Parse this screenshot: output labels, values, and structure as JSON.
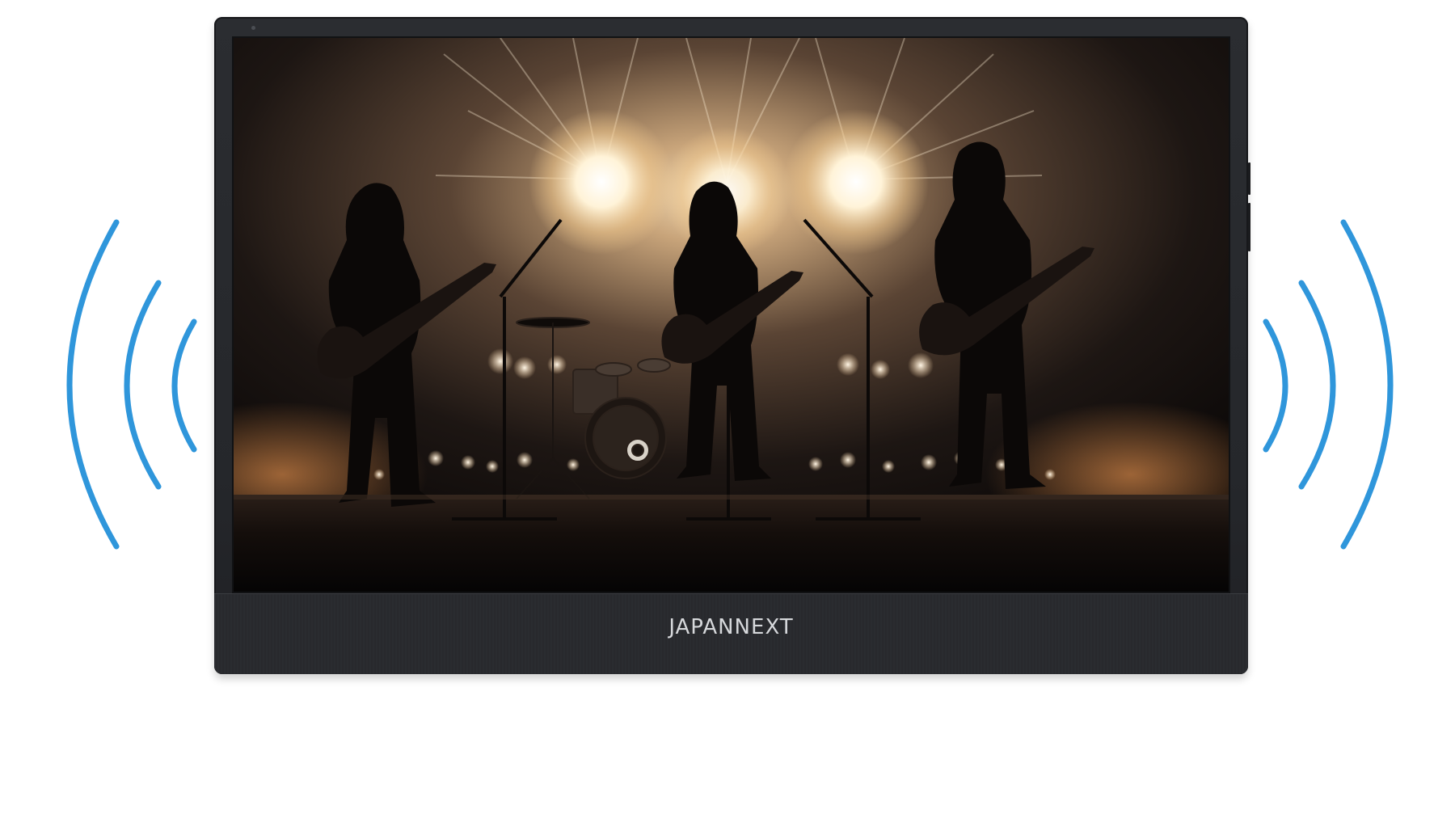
{
  "brand": {
    "logo_text": "JAPANNEXT"
  },
  "screen": {
    "scene": "concert-band-silhouette"
  },
  "colors": {
    "bezel": "#26282c",
    "sound_wave": "#2f96db",
    "brand_text": "#d6d8db"
  },
  "icons": {
    "left_waves": "sound-wave-left-icon",
    "right_waves": "sound-wave-right-icon"
  }
}
